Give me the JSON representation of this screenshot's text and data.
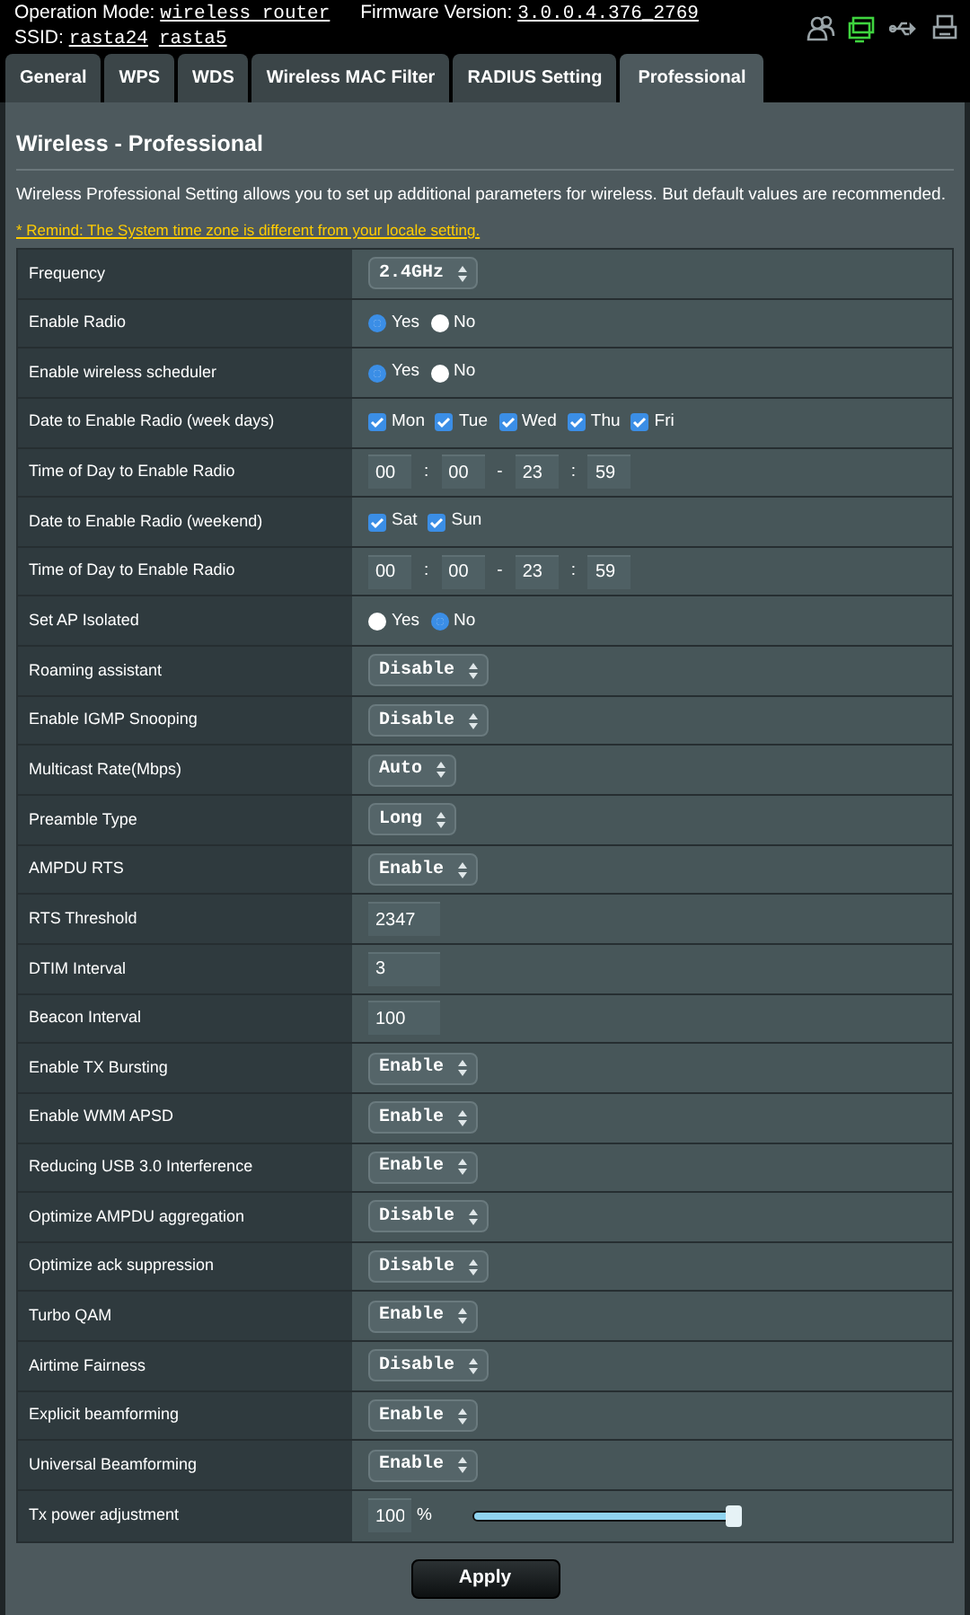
{
  "header": {
    "operation_mode_label": "Operation Mode:",
    "operation_mode": "wireless router",
    "firmware_label": "Firmware Version:",
    "firmware": "3.0.0.4.376_2769",
    "ssid_label": "SSID:",
    "ssids": [
      "rasta24",
      "rasta5"
    ]
  },
  "status_icons": [
    {
      "kind": "clients",
      "active": false
    },
    {
      "kind": "network",
      "active": true
    },
    {
      "kind": "usb",
      "active": false
    },
    {
      "kind": "printer",
      "active": false
    }
  ],
  "tabs": [
    {
      "label": "General",
      "selected": false
    },
    {
      "label": "WPS",
      "selected": false
    },
    {
      "label": "WDS",
      "selected": false
    },
    {
      "label": "Wireless MAC Filter",
      "selected": false
    },
    {
      "label": "RADIUS Setting",
      "selected": false
    },
    {
      "label": "Professional",
      "selected": true
    }
  ],
  "panel": {
    "title": "Wireless - Professional",
    "description": "Wireless Professional Setting allows you to set up additional parameters for wireless. But default values are recommended.",
    "remind": "* Remind: The System time zone is different from your locale setting."
  },
  "settings": [
    {
      "label": "Frequency",
      "kind": "select",
      "value": "2.4GHz"
    },
    {
      "label": "Enable Radio",
      "kind": "radio",
      "options": [
        {
          "label": "Yes",
          "selected": true
        },
        {
          "label": "No",
          "selected": false
        }
      ]
    },
    {
      "label": "Enable wireless scheduler",
      "kind": "radio",
      "options": [
        {
          "label": "Yes",
          "selected": true
        },
        {
          "label": "No",
          "selected": false
        }
      ]
    },
    {
      "label": "Date to Enable Radio (week days)",
      "kind": "checks",
      "options": [
        {
          "label": "Mon",
          "checked": true
        },
        {
          "label": "Tue",
          "checked": true
        },
        {
          "label": "Wed",
          "checked": true
        },
        {
          "label": "Thu",
          "checked": true
        },
        {
          "label": "Fri",
          "checked": true
        }
      ]
    },
    {
      "label": "Time of Day to Enable Radio",
      "kind": "time",
      "fields": [
        "00",
        "00",
        "23",
        "59"
      ],
      "separators": [
        ":",
        "-",
        ":"
      ]
    },
    {
      "label": "Date to Enable Radio (weekend)",
      "kind": "checks",
      "options": [
        {
          "label": "Sat",
          "checked": true
        },
        {
          "label": "Sun",
          "checked": true
        }
      ]
    },
    {
      "label": "Time of Day to Enable Radio",
      "kind": "time",
      "fields": [
        "00",
        "00",
        "23",
        "59"
      ],
      "separators": [
        ":",
        "-",
        ":"
      ]
    },
    {
      "label": "Set AP Isolated",
      "kind": "radio",
      "options": [
        {
          "label": "Yes",
          "selected": false
        },
        {
          "label": "No",
          "selected": true
        }
      ]
    },
    {
      "label": "Roaming assistant",
      "kind": "select",
      "value": "Disable"
    },
    {
      "label": "Enable IGMP Snooping",
      "kind": "select",
      "value": "Disable"
    },
    {
      "label": "Multicast Rate(Mbps)",
      "kind": "select",
      "value": "Auto"
    },
    {
      "label": "Preamble Type",
      "kind": "select",
      "value": "Long"
    },
    {
      "label": "AMPDU RTS",
      "kind": "select",
      "value": "Enable"
    },
    {
      "label": "RTS Threshold",
      "kind": "text",
      "value": "2347"
    },
    {
      "label": "DTIM Interval",
      "kind": "text",
      "value": "3"
    },
    {
      "label": "Beacon Interval",
      "kind": "text",
      "value": "100"
    },
    {
      "label": "Enable TX Bursting",
      "kind": "select",
      "value": "Enable"
    },
    {
      "label": "Enable WMM APSD",
      "kind": "select",
      "value": "Enable"
    },
    {
      "label": "Reducing USB 3.0 Interference",
      "kind": "select",
      "value": "Enable"
    },
    {
      "label": "Optimize AMPDU aggregation",
      "kind": "select",
      "value": "Disable"
    },
    {
      "label": "Optimize ack suppression",
      "kind": "select",
      "value": "Disable"
    },
    {
      "label": "Turbo QAM",
      "kind": "select",
      "value": "Enable"
    },
    {
      "label": "Airtime Fairness",
      "kind": "select",
      "value": "Disable"
    },
    {
      "label": "Explicit beamforming",
      "kind": "select",
      "value": "Enable"
    },
    {
      "label": "Universal Beamforming",
      "kind": "select",
      "value": "Enable"
    },
    {
      "label": "Tx power adjustment",
      "kind": "slider",
      "value": "100",
      "unit": "%",
      "level": 1
    }
  ],
  "apply": "Apply"
}
